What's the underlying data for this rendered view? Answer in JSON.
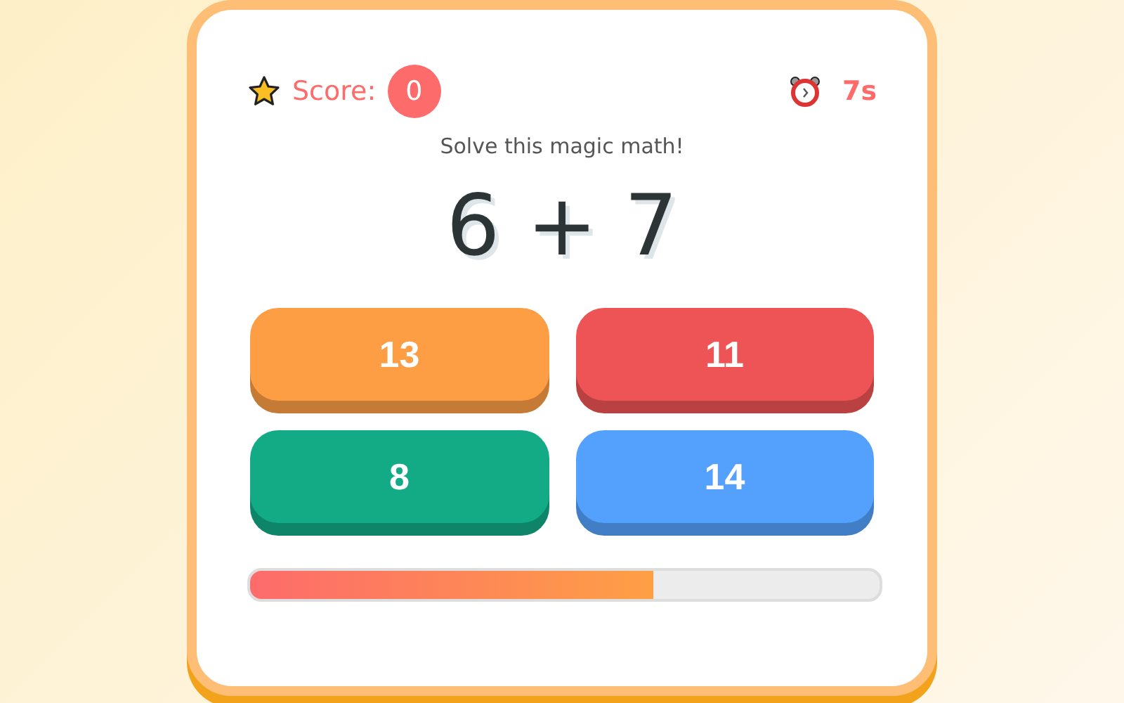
{
  "score": {
    "label": "Score:",
    "value": "0"
  },
  "timer": "7s",
  "prompt": "Solve this magic math!",
  "problem": "6 + 7",
  "answers": [
    {
      "label": "13",
      "color": "#fd9e45"
    },
    {
      "label": "11",
      "color": "#ee5355"
    },
    {
      "label": "8",
      "color": "#12ab85"
    },
    {
      "label": "14",
      "color": "#54a1fd"
    }
  ],
  "progress": {
    "level": 0.64
  }
}
